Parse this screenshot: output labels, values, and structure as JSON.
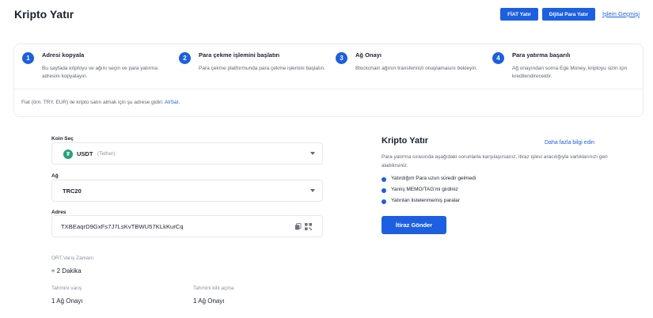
{
  "header": {
    "title": "Kripto Yatır",
    "fiat_button": "FİAT Yatır",
    "crypto_button": "Dijital Para Yatır",
    "history_link": "İşlem Geçmişi"
  },
  "steps": [
    {
      "num": "1",
      "title": "Adresi kopyala",
      "desc": "Bu sayfada kriptoyu ve ağını seçin ve para yatırma adresini kopyalayın."
    },
    {
      "num": "2",
      "title": "Para çekme işlemini başlatın",
      "desc": "Para çekme platformunda para çekme işlemini başlatın."
    },
    {
      "num": "3",
      "title": "Ağ Onayı",
      "desc": "Blockchain ağının transferinizi onaylamasını bekleyin."
    },
    {
      "num": "4",
      "title": "Para yatırma başarılı",
      "desc": "Ağ onayından sonra Ege Money, kriptoyu sizin için kredilendirecektir."
    }
  ],
  "fiat_note": {
    "text": "Fiat (örn. TRY, EUR) ile kripto satın almak için şu adrese gidin: ",
    "link": "Al/Sat."
  },
  "form": {
    "coin_label": "Koin Seç",
    "coin_code": "USDT",
    "coin_name": "(Tether)",
    "coin_icon": "tether-icon",
    "network_label": "Ağ",
    "network_value": "TRC20",
    "address_label": "Adres",
    "address_value": "TXBEaqrD9GxFs7J7LsKvTBWU57KLkKurCq"
  },
  "info": {
    "avg_time_label": "ORT.Varış Zamanı",
    "avg_time_value": "≈ 2 Dakika",
    "est_arrival_label": "Tahmini varış",
    "est_arrival_value": "1 Ağ Onayı",
    "est_unlock_label": "Tahmini kilit açma",
    "est_unlock_value": "1 Ağ Onayı"
  },
  "side": {
    "title": "Kripto Yatır",
    "more_link": "Daha fazla bilgi edin",
    "desc": "Para yatırma sırasında aşağıdaki sorunlarla karşılaşırsanız, itiraz işlevi aracılığıyla varlıklarınızı geri alabilirsiniz.",
    "issues": [
      "Yatırdığım Para uzun süredir gelmedi",
      "Yanlış MEMO/TAG'mi girdiniz",
      "Yatırılan listelenmemiş paralar"
    ],
    "appeal_button": "İtiraz Gönder"
  },
  "colors": {
    "accent": "#1c5fe0",
    "tether": "#26a17b"
  }
}
